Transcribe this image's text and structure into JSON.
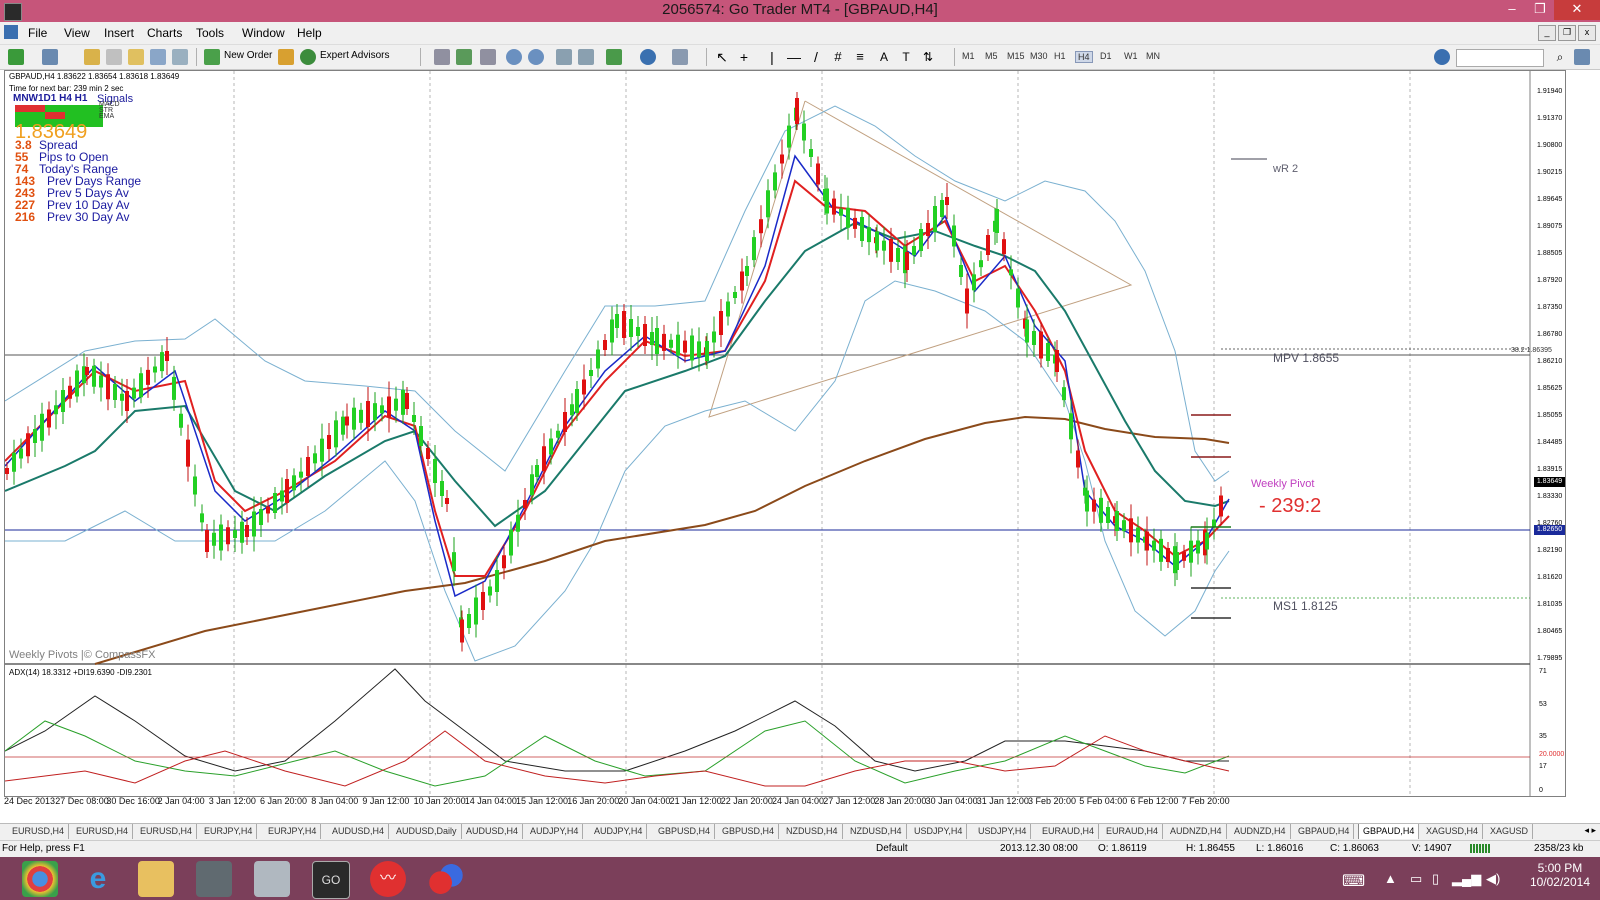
{
  "window": {
    "title": "2056574: Go Trader MT4 - [GBPAUD,H4]"
  },
  "menu": [
    "File",
    "View",
    "Insert",
    "Charts",
    "Tools",
    "Window",
    "Help"
  ],
  "toolbar": {
    "new_order": "New Order",
    "expert_advisors": "Expert Advisors",
    "timeframes": [
      "M1",
      "M5",
      "M15",
      "M30",
      "H1",
      "H4",
      "D1",
      "W1",
      "MN"
    ],
    "active_timeframe": "H4"
  },
  "chart": {
    "symbol_header": "GBPAUD,H4  1.83622 1.83654 1.83618 1.83649",
    "next_bar": "Time for next bar: 239 min 2 sec",
    "signals": {
      "timeframes": "MNW1D1 H4 H1",
      "label": "Signals",
      "rows": [
        "MACD",
        "STR",
        "EMA"
      ]
    },
    "big_price": "1.83649",
    "stats": [
      {
        "value": "3.8",
        "label": "Spread"
      },
      {
        "value": "55",
        "label": "Pips to Open"
      },
      {
        "value": "74",
        "label": "Today's Range"
      },
      {
        "value": "143",
        "label": "Prev Days Range"
      },
      {
        "value": "243",
        "label": "Prev 5 Days Av"
      },
      {
        "value": "227",
        "label": "Prev 10 Day Av"
      },
      {
        "value": "216",
        "label": "Prev 30 Day Av"
      }
    ],
    "watermark": "Weekly Pivots |© CompassFX",
    "pivots": {
      "wr2": "wR 2",
      "mpv": "MPV  1.8655",
      "weekly_pivot": "Weekly Pivot",
      "timer": "239:2",
      "ms1": "MS1  1.8125",
      "fib": "38.2  1.86395"
    },
    "price_axis": [
      "1.91940",
      "1.91370",
      "1.90800",
      "1.90215",
      "1.89645",
      "1.89075",
      "1.88505",
      "1.87920",
      "1.87350",
      "1.86780",
      "1.86210",
      "1.85625",
      "1.85055",
      "1.84485",
      "1.83915",
      "1.83330",
      "1.82760",
      "1.82190",
      "1.81620",
      "1.81035",
      "1.80465",
      "1.79895"
    ],
    "current_price_label": "1.83649",
    "hline_price_label": "1.82650",
    "adx_header": "ADX(14) 18.3312 +DI19.6390 -DI9.2301",
    "adx_axis": [
      "71",
      "53",
      "35",
      "20.0000",
      "17",
      "0"
    ],
    "dates": [
      "24 Dec 2013",
      "27 Dec 08:00",
      "30 Dec 16:00",
      "2 Jan 04:00",
      "3 Jan 12:00",
      "6 Jan 20:00",
      "8 Jan 04:00",
      "9 Jan 12:00",
      "10 Jan 20:00",
      "14 Jan 04:00",
      "15 Jan 12:00",
      "16 Jan 20:00",
      "20 Jan 04:00",
      "21 Jan 12:00",
      "22 Jan 20:00",
      "24 Jan 04:00",
      "27 Jan 12:00",
      "28 Jan 20:00",
      "30 Jan 04:00",
      "31 Jan 12:00",
      "3 Feb 20:00",
      "5 Feb 04:00",
      "6 Feb 12:00",
      "7 Feb 20:00"
    ]
  },
  "tabs": [
    "EURUSD,H4",
    "EURUSD,H4",
    "EURUSD,H4",
    "EURJPY,H4",
    "EURJPY,H4",
    "AUDUSD,H4",
    "AUDUSD,Daily",
    "AUDUSD,H4",
    "AUDJPY,H4",
    "AUDJPY,H4",
    "GBPUSD,H4",
    "GBPUSD,H4",
    "NZDUSD,H4",
    "NZDUSD,H4",
    "USDJPY,H4",
    "USDJPY,H4",
    "EURAUD,H4",
    "EURAUD,H4",
    "AUDNZD,H4",
    "AUDNZD,H4",
    "GBPAUD,H4",
    "GBPAUD,H4",
    "XAGUSD,H4",
    "XAGUSD"
  ],
  "active_tab_index": 21,
  "status": {
    "help": "For Help, press F1",
    "profile": "Default",
    "datetime": "2013.12.30 08:00",
    "open": "O: 1.86119",
    "high": "H: 1.86455",
    "low": "L: 1.86016",
    "close": "C: 1.86063",
    "volume": "V: 14907",
    "traffic": "2358/23 kb"
  },
  "taskbar": {
    "time": "5:00 PM",
    "date": "10/02/2014"
  }
}
